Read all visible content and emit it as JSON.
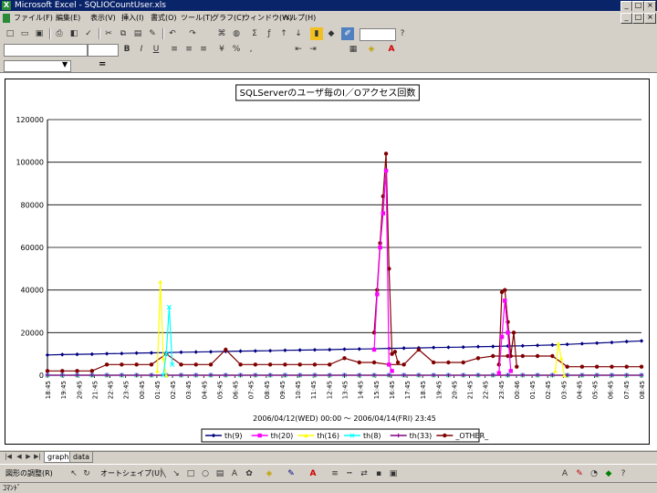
{
  "window": {
    "app": "Microsoft Excel",
    "title": "Microsoft Excel - SQLIOCountUser.xls"
  },
  "menu": [
    "ファイル(F)",
    "編集(E)",
    "表示(V)",
    "挿入(I)",
    "書式(O)",
    "ツール(T)",
    "グラフ(C)",
    "ウィンドウ(W)",
    "ヘルプ(H)"
  ],
  "formula": {
    "equals": "="
  },
  "sheet_tabs": [
    "graph",
    "data"
  ],
  "active_tab": "graph",
  "drawing": {
    "draw_label": "図形の調整(R)",
    "autoshape_label": "オートシェイプ(U)"
  },
  "status": {
    "text": "ｺﾏﾝﾄﾞ"
  },
  "chart_data": {
    "type": "line",
    "title": "SQLServerのユーザ毎のI／Oアクセス回数",
    "xlabel": "2006/04/12(WED) 00:00 ～ 2006/04/14(FRI) 23:45",
    "ylim": [
      0,
      120000
    ],
    "yticks": [
      0,
      20000,
      40000,
      60000,
      80000,
      100000,
      120000
    ],
    "x_tick_labels": [
      "18:45",
      "19:45",
      "20:45",
      "21:45",
      "22:45",
      "23:45",
      "00:45",
      "01:45",
      "02:45",
      "03:45",
      "04:45",
      "05:45",
      "06:45",
      "07:45",
      "08:45",
      "09:45",
      "10:45",
      "11:45",
      "12:45",
      "13:45",
      "14:45",
      "15:45",
      "16:45",
      "17:45",
      "18:45",
      "19:45",
      "20:45",
      "21:45",
      "22:45",
      "23:45",
      "00:46",
      "01:45",
      "02:45",
      "03:45",
      "04:45",
      "05:45",
      "06:45",
      "07:45",
      "08:45"
    ],
    "legend_position": "bottom",
    "grid": true,
    "series": [
      {
        "name": "th(9)",
        "color": "#000080",
        "marker": "diamond",
        "values": [
          9500,
          9700,
          9800,
          9900,
          10100,
          10200,
          10400,
          10500,
          10600,
          10800,
          10900,
          11000,
          11200,
          11300,
          11400,
          11500,
          11700,
          11800,
          11900,
          12000,
          12200,
          12300,
          12400,
          12600,
          12700,
          12800,
          13000,
          13100,
          13200,
          13400,
          13500,
          13700,
          13800,
          14000,
          14200,
          14500,
          14800,
          15100,
          15400,
          15800,
          16100
        ]
      },
      {
        "name": "th(20)",
        "color": "#ff00ff",
        "marker": "square",
        "values": [
          0,
          0,
          0,
          0,
          0,
          0,
          0,
          0,
          0,
          0,
          0,
          0,
          0,
          0,
          0,
          0,
          0,
          0,
          0,
          0,
          0,
          0,
          0,
          0,
          0,
          0,
          0,
          0,
          0,
          0,
          0,
          0,
          0,
          0,
          0,
          0,
          0,
          0,
          0,
          0,
          0
        ]
      },
      {
        "name": "th(16)",
        "color": "#ffff00",
        "marker": "triangle",
        "values": [
          0,
          0,
          0,
          0,
          0,
          0,
          0,
          0,
          0,
          0,
          0,
          0,
          0,
          0,
          0,
          0,
          0,
          0,
          0,
          0,
          0,
          0,
          0,
          0,
          0,
          0,
          0,
          0,
          0,
          0,
          0,
          0,
          0,
          0,
          0,
          0,
          0,
          0,
          0,
          0,
          0
        ]
      },
      {
        "name": "th(8)",
        "color": "#00ffff",
        "marker": "x",
        "values": [
          0,
          0,
          0,
          0,
          0,
          0,
          0,
          0,
          0,
          0,
          0,
          0,
          0,
          0,
          0,
          0,
          0,
          0,
          0,
          0,
          0,
          0,
          0,
          0,
          0,
          0,
          0,
          0,
          0,
          0,
          0,
          0,
          0,
          0,
          0,
          0,
          0,
          0,
          0,
          0,
          0
        ]
      },
      {
        "name": "th(33)",
        "color": "#800080",
        "marker": "star",
        "values": [
          0,
          0,
          0,
          0,
          0,
          0,
          0,
          0,
          0,
          0,
          0,
          0,
          0,
          0,
          0,
          0,
          0,
          0,
          0,
          0,
          0,
          0,
          0,
          0,
          0,
          0,
          0,
          0,
          0,
          0,
          0,
          0,
          0,
          0,
          0,
          0,
          0,
          0,
          0,
          0,
          0
        ]
      },
      {
        "name": "_OTHER_",
        "color": "#800000",
        "marker": "circle",
        "values": [
          2000,
          2000,
          2000,
          2000,
          5000,
          5000,
          5000,
          5000,
          10000,
          5000,
          5000,
          5000,
          12000,
          5000,
          5000,
          5000,
          5000,
          5000,
          5000,
          5000,
          8000,
          6000,
          6000,
          5000,
          5000,
          12000,
          6000,
          6000,
          6000,
          8000,
          9000,
          9000,
          9000,
          9000,
          9000,
          4000,
          4000,
          4000,
          4000,
          4000,
          4000
        ]
      }
    ],
    "spikes": [
      {
        "series": "_OTHER_",
        "x": [
          22.0,
          22.2,
          22.4,
          22.6,
          22.8,
          23.0,
          23.2,
          23.4,
          23.6
        ],
        "y": [
          20000,
          40000,
          62000,
          84000,
          104000,
          50000,
          10000,
          11000,
          6000
        ]
      },
      {
        "series": "th(20)",
        "x": [
          22.0,
          22.2,
          22.4,
          22.6,
          22.8,
          23.0,
          23.2
        ],
        "y": [
          12000,
          38000,
          60000,
          76000,
          96000,
          5000,
          2000
        ]
      },
      {
        "series": "th(16)",
        "x": [
          7.4,
          7.6,
          7.8,
          8.0
        ],
        "y": [
          2000,
          44000,
          8000,
          0
        ]
      },
      {
        "series": "th(8)",
        "x": [
          7.8,
          8.0,
          8.2,
          8.4
        ],
        "y": [
          0,
          10000,
          32000,
          5000
        ]
      },
      {
        "series": "_OTHER_",
        "x": [
          30.4,
          30.6,
          30.8,
          31.0,
          31.2,
          31.4,
          31.6
        ],
        "y": [
          5000,
          39000,
          40000,
          25000,
          9000,
          20000,
          4000
        ]
      },
      {
        "series": "th(20)",
        "x": [
          30.4,
          30.6,
          30.8,
          31.0,
          31.2
        ],
        "y": [
          1000,
          18000,
          35000,
          20000,
          2000
        ]
      },
      {
        "series": "th(16)",
        "x": [
          34.2,
          34.4,
          34.6,
          34.8
        ],
        "y": [
          2000,
          15000,
          8000,
          0
        ]
      }
    ]
  }
}
